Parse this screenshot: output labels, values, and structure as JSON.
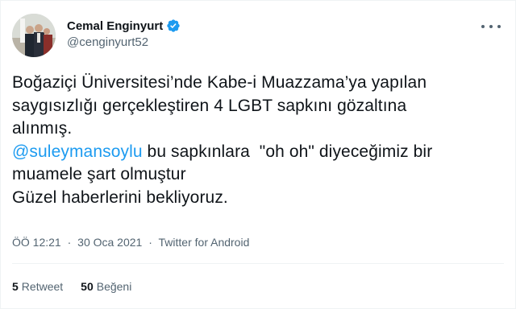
{
  "user": {
    "display_name": "Cemal Enginyurt",
    "handle": "@cenginyurt52",
    "verified_icon": "verified-badge-icon",
    "accent_color": "#1d9bf0"
  },
  "tweet": {
    "line1": "Boğaziçi Üniversitesi’nde Kabe-i Muazzama’ya yapılan",
    "line2": "saygısızlığı gerçekleştiren 4 LGBT sapkını gözaltına",
    "line3": "alınmış.",
    "mention": "@suleymansoylu",
    "line4_rest": " bu sapkınlara  \"oh oh\" diyeceğimiz bir",
    "line5": "muamele şart olmuştur",
    "line6": "Güzel haberlerini bekliyoruz."
  },
  "meta": {
    "time": "ÖÖ 12:21",
    "separator": "·",
    "date": "30 Oca 2021",
    "source": "Twitter for Android"
  },
  "stats": {
    "retweet_count": "5",
    "retweet_label": "Retweet",
    "like_count": "50",
    "like_label": "Beğeni"
  }
}
